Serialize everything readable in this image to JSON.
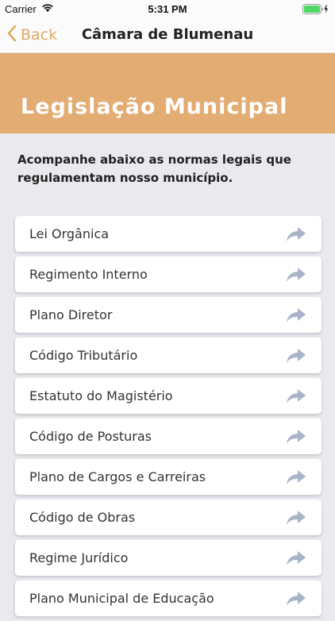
{
  "status_bar": {
    "carrier": "Carrier",
    "time": "5:31 PM"
  },
  "nav": {
    "back_label": "Back",
    "title": "Câmara de Blumenau"
  },
  "banner": {
    "title": "Legislação Municipal"
  },
  "intro": {
    "text": "Acompanhe abaixo as normas legais que regulamentam nosso município."
  },
  "items": [
    {
      "label": "Lei Orgânica"
    },
    {
      "label": "Regimento Interno"
    },
    {
      "label": "Plano Diretor"
    },
    {
      "label": "Código Tributário"
    },
    {
      "label": "Estatuto do Magistério"
    },
    {
      "label": "Código de Posturas"
    },
    {
      "label": "Plano de Cargos e Carreiras"
    },
    {
      "label": "Código de Obras"
    },
    {
      "label": "Regime Jurídico"
    },
    {
      "label": "Plano Municipal de Educação"
    }
  ],
  "colors": {
    "accent": "#e2ac72",
    "back": "#e1a965",
    "arrow": "#aab4c8",
    "battery": "#4cd964"
  },
  "icons": {
    "wifi": "wifi-icon",
    "battery": "battery-icon",
    "back": "chevron-left-icon",
    "row": "share-arrow-icon"
  }
}
